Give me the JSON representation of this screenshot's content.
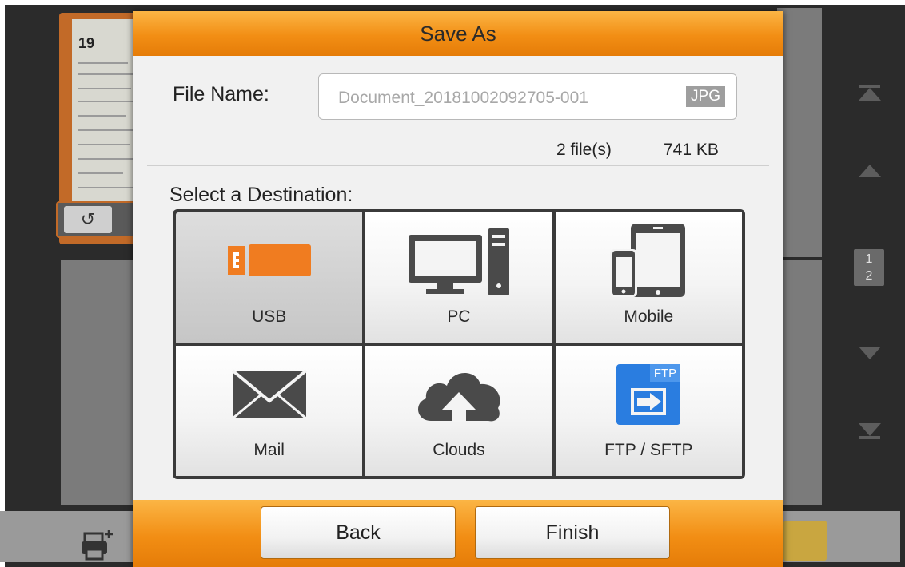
{
  "background": {
    "thumbnail_page_number": "19",
    "page_indicator": {
      "current": "1",
      "total": "2"
    }
  },
  "dialog": {
    "title": "Save As",
    "file_name_label": "File Name:",
    "file_name_value": "Document_20181002092705-001",
    "file_extension": "JPG",
    "file_count": "2 file(s)",
    "file_size": "741 KB",
    "destination_label": "Select a Destination:",
    "destinations": [
      {
        "label": "USB",
        "icon": "usb-drive-icon",
        "selected": true
      },
      {
        "label": "PC",
        "icon": "desktop-computer-icon",
        "selected": false
      },
      {
        "label": "Mobile",
        "icon": "mobile-devices-icon",
        "selected": false
      },
      {
        "label": "Mail",
        "icon": "envelope-icon",
        "selected": false
      },
      {
        "label": "Clouds",
        "icon": "cloud-upload-icon",
        "selected": false
      },
      {
        "label": "FTP / SFTP",
        "icon": "ftp-folder-icon",
        "icon_text": "FTP",
        "selected": false
      }
    ],
    "back_label": "Back",
    "finish_label": "Finish"
  },
  "colors": {
    "accent_orange": "#f28e14",
    "usb_orange": "#f07c20",
    "ftp_blue": "#2a7de0",
    "background_dark": "#2b2b2b"
  }
}
